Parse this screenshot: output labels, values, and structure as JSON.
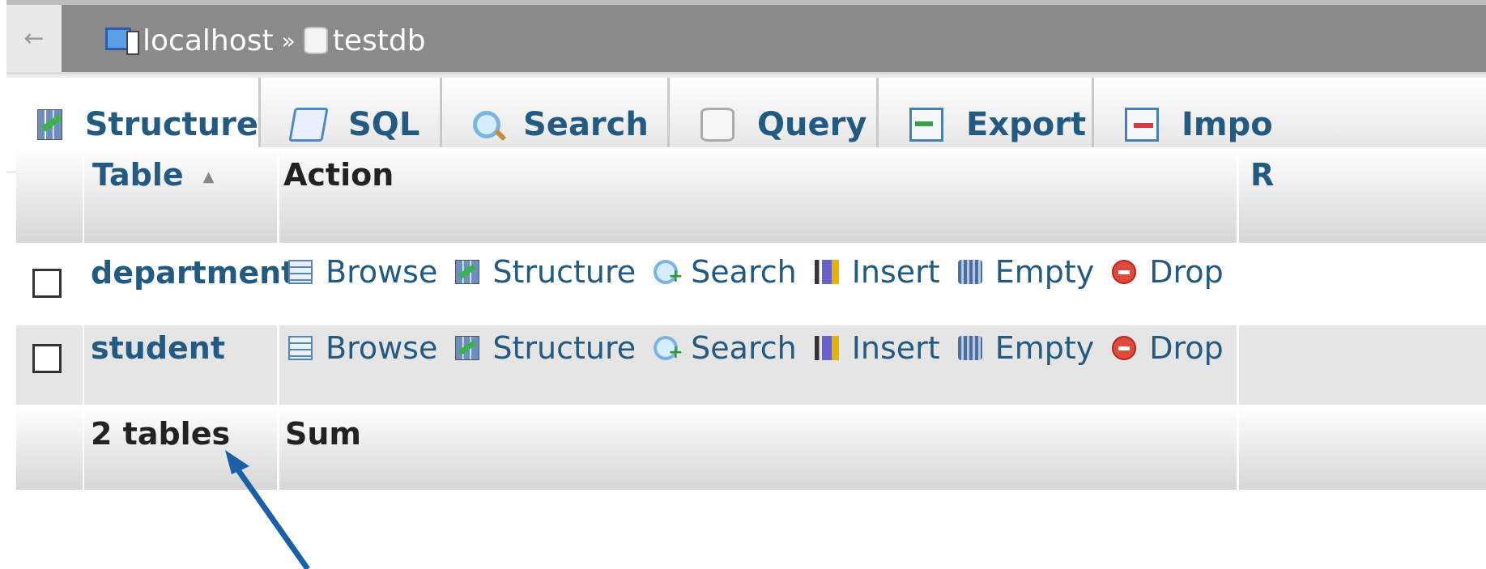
{
  "nav": {
    "back_glyph": "←",
    "breadcrumb": [
      {
        "label": "localhost",
        "icon": "server-icon"
      },
      {
        "label": "testdb",
        "icon": "database-icon"
      }
    ],
    "separator": "»"
  },
  "tabs": [
    {
      "label": "Structure",
      "icon": "structure-icon",
      "active": true
    },
    {
      "label": "SQL",
      "icon": "sql-icon"
    },
    {
      "label": "Search",
      "icon": "search-icon"
    },
    {
      "label": "Query",
      "icon": "query-icon"
    },
    {
      "label": "Export",
      "icon": "export-icon"
    },
    {
      "label": "Impo",
      "icon": "import-icon"
    }
  ],
  "table": {
    "headers": {
      "table": "Table",
      "action": "Action",
      "rows_partial": "R"
    },
    "rows": [
      {
        "name": "department",
        "actions": [
          "Browse",
          "Structure",
          "Search",
          "Insert",
          "Empty",
          "Drop"
        ]
      },
      {
        "name": "student",
        "actions": [
          "Browse",
          "Structure",
          "Search",
          "Insert",
          "Empty",
          "Drop"
        ]
      }
    ],
    "footer": {
      "count_label": "2 tables",
      "sum_label": "Sum"
    }
  },
  "annotation": {
    "arrow_color": "#1a5fa8",
    "points_to": "student"
  }
}
